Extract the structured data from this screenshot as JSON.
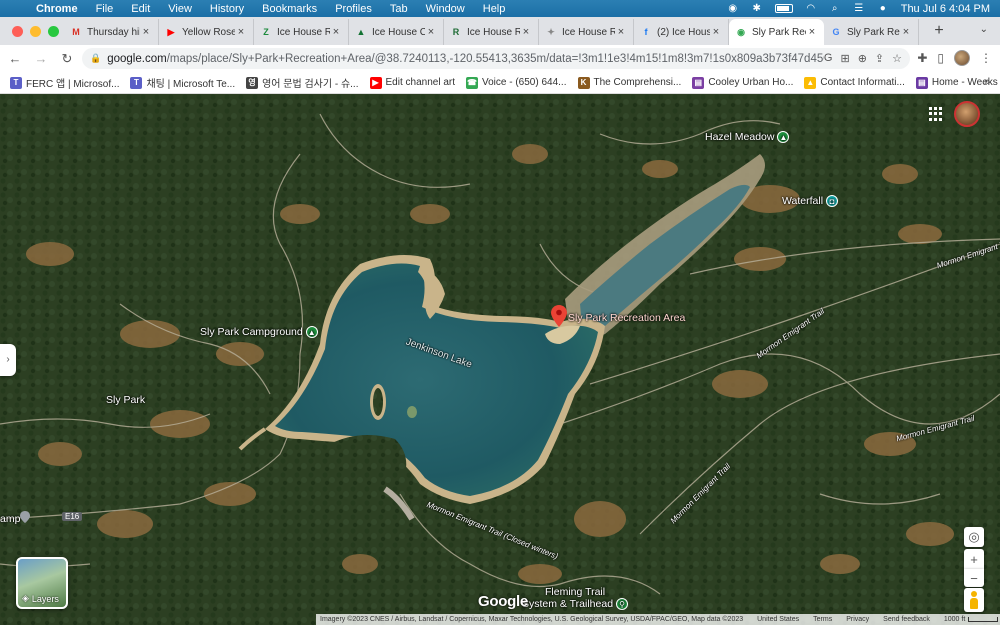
{
  "menubar": {
    "apple": "",
    "app": "Chrome",
    "items": [
      "File",
      "Edit",
      "View",
      "History",
      "Bookmarks",
      "Profiles",
      "Tab",
      "Window",
      "Help"
    ],
    "datetime": "Thu Jul 6  4:04 PM"
  },
  "tabs": [
    {
      "label": "Thursday hik",
      "favicon": "gmail-icon",
      "badge": "M",
      "color": "#d93025"
    },
    {
      "label": "Yellow Rose",
      "favicon": "youtube-icon",
      "badge": "▶",
      "color": "#ff0000"
    },
    {
      "label": "Ice House Re",
      "favicon": "zillow-icon",
      "badge": "Z",
      "color": "#1b8a3c"
    },
    {
      "label": "Ice House C",
      "favicon": "triangle-icon",
      "badge": "▲",
      "color": "#137333"
    },
    {
      "label": "Ice House Re",
      "favicon": "recreation-icon",
      "badge": "R",
      "color": "#1e6b34"
    },
    {
      "label": "Ice House Re",
      "favicon": "camp-icon",
      "badge": "✦",
      "color": "#888888"
    },
    {
      "label": "(2) Ice House",
      "favicon": "facebook-icon",
      "badge": "f",
      "color": "#1877f2"
    },
    {
      "label": "Sly Park Rec",
      "favicon": "maps-icon",
      "badge": "◉",
      "color": "#34a853",
      "active": true
    },
    {
      "label": "Sly Park Rec",
      "favicon": "google-icon",
      "badge": "G",
      "color": "#4285f4"
    }
  ],
  "toolbar": {
    "url_host": "google.com",
    "url_rest": "/maps/place/Sly+Park+Recreation+Area/@38.7240113,-120.55413,3635m/data=!3m1!1e3!4m15!1m8!3m7!1s0x809a3b73f47d4509:0x9a96a..."
  },
  "bookmarks": [
    {
      "label": "FERC 앱 | Microsof...",
      "color": "#5b5fc7",
      "glyph": "T"
    },
    {
      "label": "채팅 | Microsoft Te...",
      "color": "#5b5fc7",
      "glyph": "T"
    },
    {
      "label": "영어 문법 검사기 - 슈...",
      "color": "#444444",
      "glyph": "영"
    },
    {
      "label": "Edit channel art",
      "color": "#ff0000",
      "glyph": "▶"
    },
    {
      "label": "Voice - (650) 644...",
      "color": "#34a853",
      "glyph": "☎"
    },
    {
      "label": "The Comprehensi...",
      "color": "#8a5a1f",
      "glyph": "K"
    },
    {
      "label": "Cooley Urban Ho...",
      "color": "#7b3fa3",
      "glyph": "▤"
    },
    {
      "label": "Contact Informati...",
      "color": "#fbbc04",
      "glyph": "▲"
    },
    {
      "label": "Home - Weeks",
      "color": "#6a3aa3",
      "glyph": "▤"
    }
  ],
  "map": {
    "labels": {
      "hazel_meadow": "Hazel Meadow",
      "waterfall": "Waterfall",
      "sly_park_campground": "Sly Park Campground",
      "sly_park_rec": "Sly Park Recreation Area",
      "jenkinson_lake": "Jenkinson Lake",
      "sly_park": "Sly Park",
      "mormon_trail_ne": "Mormon Emigrant Trail",
      "mormon_trail_e": "Mormon Emigrant Trail",
      "mormon_trail_mid": "Mormon Emigrant Trail",
      "mormon_trail_se": "Mormon Emigrant Trail",
      "mormon_trail_closed": "Mormon Emigrant Trail (Closed winters)",
      "fleming_trail_1": "Fleming Trail",
      "fleming_trail_2": "System & Trailhead",
      "road_e16": "E16",
      "camp_partial": "amp"
    },
    "layers_label": "Layers",
    "google_logo": "Google",
    "footer": {
      "imagery": "Imagery ©2023 CNES / Airbus, Landsat / Copernicus, Maxar Technologies, U.S. Geological Survey, USDA/FPAC/GEO, Map data ©2023",
      "country": "United States",
      "terms": "Terms",
      "privacy": "Privacy",
      "feedback": "Send feedback",
      "scale": "1000 ft"
    }
  }
}
